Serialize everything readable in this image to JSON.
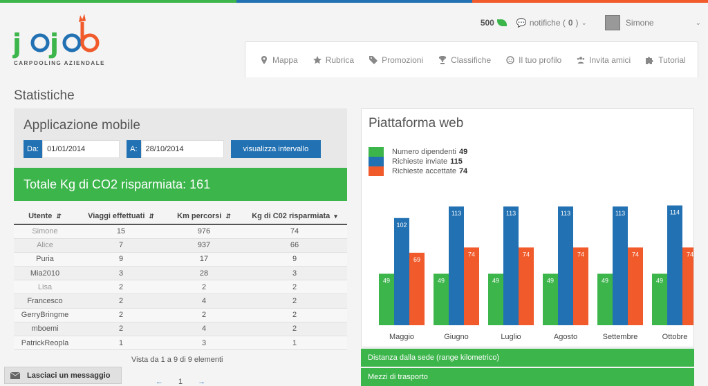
{
  "colors": {
    "green": "#3cb54b",
    "blue": "#2271b3",
    "orange": "#f15a2b"
  },
  "header": {
    "logo_text": "jojob",
    "logo_subtitle": "CARPOOLING AZIENDALE",
    "points": "500",
    "notifications_label": "notifiche (",
    "notifications_count": "0",
    "notifications_close": ")",
    "user_name": "Simone"
  },
  "nav": [
    {
      "label": "Mappa",
      "icon": "map-marker-icon"
    },
    {
      "label": "Rubrica",
      "icon": "star-icon"
    },
    {
      "label": "Promozioni",
      "icon": "tag-icon"
    },
    {
      "label": "Classifiche",
      "icon": "trophy-icon"
    },
    {
      "label": "Il tuo profilo",
      "icon": "smile-icon"
    },
    {
      "label": "Invita amici",
      "icon": "users-icon"
    },
    {
      "label": "Tutorial",
      "icon": "puzzle-icon"
    }
  ],
  "page_title": "Statistiche",
  "mobile": {
    "title": "Applicazione mobile",
    "from_label": "Da:",
    "from_value": "01/01/2014",
    "to_label": "A:",
    "to_value": "28/10/2014",
    "button": "visualizza intervallo",
    "co2_total": "Totale Kg di CO2 risparmiata: 161"
  },
  "table": {
    "headers": [
      "Utente",
      "Viaggi effettuati",
      "Km percorsi",
      "Kg di C02 risparmiata"
    ],
    "rows": [
      {
        "user": "Simone",
        "trips": "15",
        "km": "976",
        "co2": "74",
        "muted": true
      },
      {
        "user": "Alice",
        "trips": "7",
        "km": "937",
        "co2": "66",
        "muted": true
      },
      {
        "user": "Puria",
        "trips": "9",
        "km": "17",
        "co2": "9",
        "muted": false
      },
      {
        "user": "Mia2010",
        "trips": "3",
        "km": "28",
        "co2": "3",
        "muted": false
      },
      {
        "user": "Lisa",
        "trips": "2",
        "km": "2",
        "co2": "2",
        "muted": true
      },
      {
        "user": "Francesco",
        "trips": "2",
        "km": "4",
        "co2": "2",
        "muted": false
      },
      {
        "user": "GerryBringme",
        "trips": "2",
        "km": "2",
        "co2": "2",
        "muted": false
      },
      {
        "user": "mboemi",
        "trips": "2",
        "km": "4",
        "co2": "2",
        "muted": false
      },
      {
        "user": "PatrickReopla",
        "trips": "1",
        "km": "3",
        "co2": "1",
        "muted": false
      }
    ],
    "footer": "Vista da 1 a 9 di 9 elementi",
    "page": "1"
  },
  "message_button": "Lasciaci un messaggio",
  "web": {
    "title": "Piattaforma web",
    "legend": [
      {
        "label": "Numero dipendenti",
        "value": "49"
      },
      {
        "label": "Richieste inviate",
        "value": "115"
      },
      {
        "label": "Richieste accettate",
        "value": "74"
      }
    ],
    "sections": [
      "Distanza dalla sede (range kilometrico)",
      "Mezzi di trasporto"
    ]
  },
  "chart_data": {
    "type": "bar",
    "categories": [
      "Maggio",
      "Giugno",
      "Luglio",
      "Agosto",
      "Settembre",
      "Ottobre"
    ],
    "series": [
      {
        "name": "Numero dipendenti",
        "values": [
          49,
          49,
          49,
          49,
          49,
          49
        ]
      },
      {
        "name": "Richieste inviate",
        "values": [
          102,
          113,
          113,
          113,
          113,
          114
        ]
      },
      {
        "name": "Richieste accettate",
        "values": [
          69,
          74,
          74,
          74,
          74,
          74
        ]
      }
    ],
    "ylim": [
      0,
      115
    ],
    "grid": false,
    "legend": "top-left"
  }
}
